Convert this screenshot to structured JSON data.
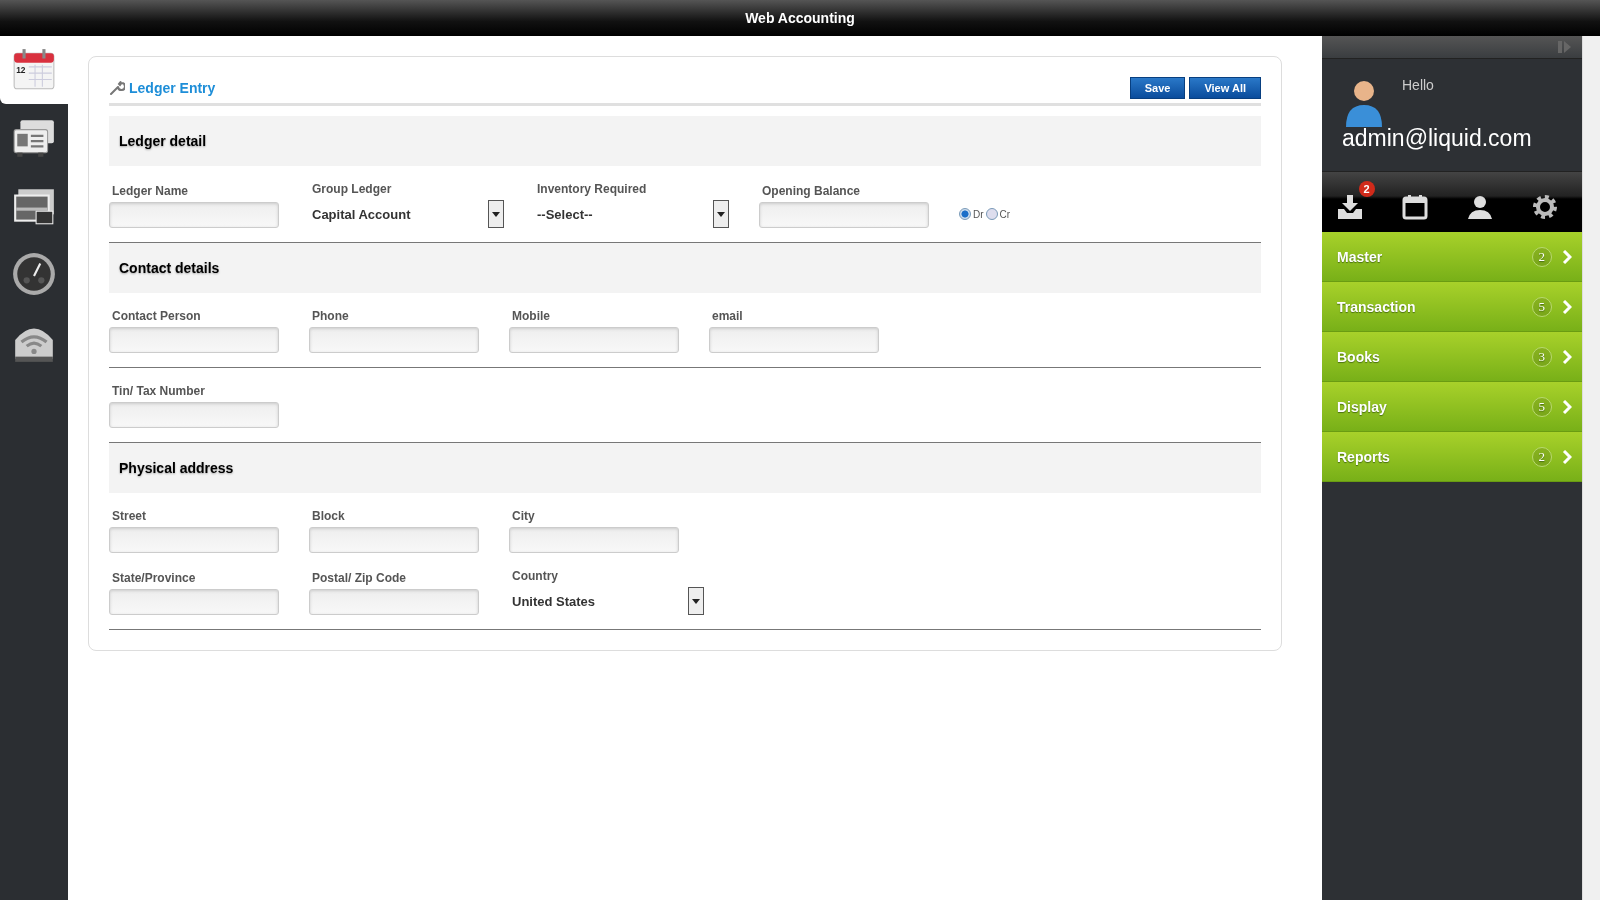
{
  "window": {
    "title": "Web Accounting"
  },
  "left_nav": [
    {
      "kind": "calendar",
      "selected": true,
      "date": "12"
    },
    {
      "kind": "contacts",
      "selected": false
    },
    {
      "kind": "photos",
      "selected": false
    },
    {
      "kind": "gauge",
      "selected": false
    },
    {
      "kind": "router",
      "selected": false
    }
  ],
  "form": {
    "title": "Ledger Entry",
    "buttons": [
      "Save",
      "View All"
    ],
    "sections": [
      {
        "heading": "Ledger detail",
        "rows": [
          [
            {
              "kind": "text",
              "label": "Ledger Name"
            },
            {
              "kind": "select",
              "label": "Group Ledger",
              "value": "Capital Account"
            },
            {
              "kind": "select",
              "label": "Inventory Required",
              "value": "--Select--"
            },
            {
              "kind": "text",
              "label": "Opening Balance"
            },
            {
              "kind": "radio",
              "options": [
                {
                  "label": "Dr",
                  "selected": true
                },
                {
                  "label": "Cr",
                  "selected": false
                }
              ]
            }
          ]
        ]
      },
      {
        "heading": "Contact details",
        "rows": [
          [
            {
              "kind": "text",
              "label": "Contact Person"
            },
            {
              "kind": "text",
              "label": "Phone"
            },
            {
              "kind": "text",
              "label": "Mobile"
            },
            {
              "kind": "text",
              "label": "email"
            }
          ]
        ]
      },
      {
        "rows": [
          [
            {
              "kind": "text",
              "label": "Tin/ Tax Number"
            }
          ]
        ]
      },
      {
        "heading": "Physical address",
        "rows": [
          [
            {
              "kind": "text",
              "label": "Street"
            },
            {
              "kind": "text",
              "label": "Block"
            },
            {
              "kind": "text",
              "label": "City"
            }
          ],
          [
            {
              "kind": "text",
              "label": "State/Province"
            },
            {
              "kind": "text",
              "label": "Postal/ Zip Code"
            },
            {
              "kind": "select",
              "label": "Country",
              "value": "United States"
            }
          ]
        ]
      }
    ]
  },
  "user_panel": {
    "greeting": "Hello",
    "user": "admin@liquid.com",
    "toolbar": [
      {
        "kind": "download",
        "badge": "2"
      },
      {
        "kind": "calendar"
      },
      {
        "kind": "person"
      },
      {
        "kind": "settings"
      }
    ],
    "menu": [
      {
        "label": "Master",
        "count": "2"
      },
      {
        "label": "Transaction",
        "count": "5"
      },
      {
        "label": "Books",
        "count": "3"
      },
      {
        "label": "Display",
        "count": "5"
      },
      {
        "label": "Reports",
        "count": "2"
      }
    ]
  }
}
